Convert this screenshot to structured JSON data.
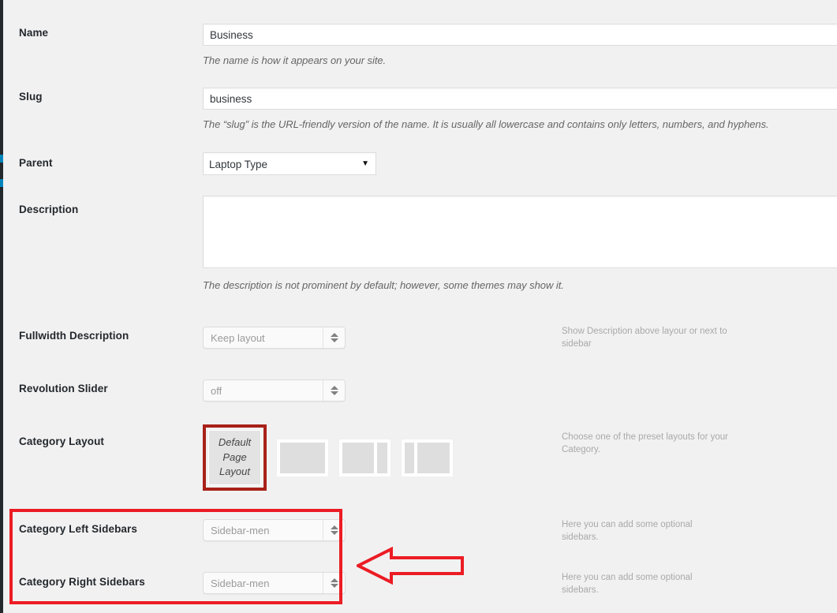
{
  "fields": {
    "name": {
      "label": "Name",
      "value": "Business",
      "hint": "The name is how it appears on your site."
    },
    "slug": {
      "label": "Slug",
      "value": "business",
      "hint": "The “slug” is the URL-friendly version of the name. It is usually all lowercase and contains only letters, numbers, and hyphens."
    },
    "parent": {
      "label": "Parent",
      "value": "Laptop Type",
      "caret": "▼"
    },
    "description": {
      "label": "Description",
      "value": "",
      "hint": "The description is not prominent by default; however, some themes may show it."
    },
    "fullwidth_description": {
      "label": "Fullwidth Description",
      "value": "Keep layout",
      "help": "Show Description above layour or next to sidebar"
    },
    "revolution_slider": {
      "label": "Revolution Slider",
      "value": "off",
      "help": ""
    },
    "category_layout": {
      "label": "Category Layout",
      "help": "Choose one of the preset layouts for your Category.",
      "default_thumb_lines": [
        "Default",
        "Page",
        "Layout"
      ],
      "presets": [
        "full-width-layout",
        "content-right-sidebar-layout",
        "left-sidebar-content-layout"
      ]
    },
    "category_left_sidebars": {
      "label": "Category Left Sidebars",
      "value": "Sidebar-men",
      "help": "Here you can add some optional sidebars."
    },
    "category_right_sidebars": {
      "label": "Category Right Sidebars",
      "value": "Sidebar-men",
      "help": "Here you can add some optional sidebars."
    }
  },
  "annotations": {
    "highlight_color": "#ec1c24",
    "selected_layout_color": "#a82119",
    "arrow_direction": "left"
  },
  "colors": {
    "page_background": "#f1f1f1",
    "admin_rail": "#23282d",
    "admin_rail_accent": "#0085ba",
    "label_text": "#23282d",
    "hint_text": "#666666",
    "help_text": "#a9a9a9"
  }
}
